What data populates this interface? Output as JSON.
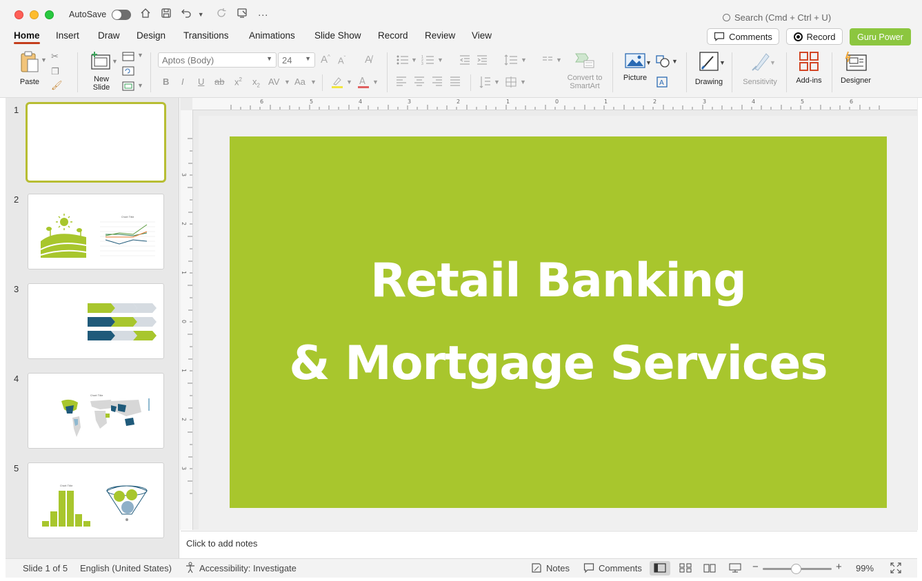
{
  "titlebar": {
    "autosave_label": "AutoSave",
    "search_placeholder": "Search (Cmd + Ctrl + U)"
  },
  "tabs": [
    "Home",
    "Insert",
    "Draw",
    "Design",
    "Transitions",
    "Animations",
    "Slide Show",
    "Record",
    "Review",
    "View"
  ],
  "header_buttons": {
    "comments": "Comments",
    "record": "Record",
    "guru": "Guru Power"
  },
  "ribbon": {
    "paste": "Paste",
    "new_slide_1": "New",
    "new_slide_2": "Slide",
    "font_name": "Aptos (Body)",
    "font_size": "24",
    "smartart_1": "Convert to",
    "smartart_2": "SmartArt",
    "picture": "Picture",
    "drawing": "Drawing",
    "sensitivity": "Sensitivity",
    "addins": "Add-ins",
    "designer": "Designer"
  },
  "thumbnails": [
    "1",
    "2",
    "3",
    "4",
    "5"
  ],
  "thumb_text": {
    "chart_title": "Chart Title"
  },
  "slide": {
    "title_line1": "Retail Banking",
    "title_line2": "& Mortgage Services",
    "bg_color": "#a8c62d"
  },
  "notes_placeholder": "Click to add notes",
  "status": {
    "slide_count": "Slide 1 of 5",
    "language": "English (United States)",
    "accessibility": "Accessibility: Investigate",
    "notes": "Notes",
    "comments": "Comments",
    "zoom": "99%"
  },
  "ruler": {
    "h_ticks": [
      "6",
      "5",
      "4",
      "3",
      "2",
      "1",
      "0",
      "1",
      "2",
      "3",
      "4",
      "5",
      "6"
    ],
    "v_ticks": [
      "3",
      "2",
      "1",
      "0",
      "1",
      "2",
      "3"
    ]
  }
}
